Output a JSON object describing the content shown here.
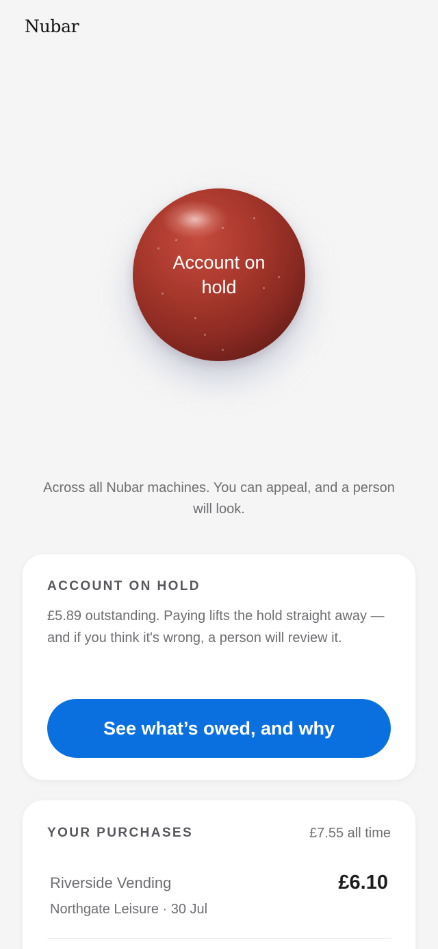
{
  "app": {
    "brand": "Nubar"
  },
  "status_orb": {
    "label": "Account on hold",
    "color": "#a8382c"
  },
  "tagline": "Across all Nubar machines. You can appeal, and a person will look.",
  "hold_card": {
    "eyebrow": "ACCOUNT ON HOLD",
    "body": "£5.89 outstanding. Paying lifts the hold straight away — and if you think it's wrong, a person will review it.",
    "cta_label": "See what’s owed, and why",
    "cta_color": "#0a70e0"
  },
  "purchases_card": {
    "eyebrow": "YOUR PURCHASES",
    "total": "£7.55 all time",
    "items": [
      {
        "merchant": "Riverside Vending",
        "location": "Northgate Leisure · 30 Jul",
        "amount": "£6.10"
      }
    ]
  }
}
